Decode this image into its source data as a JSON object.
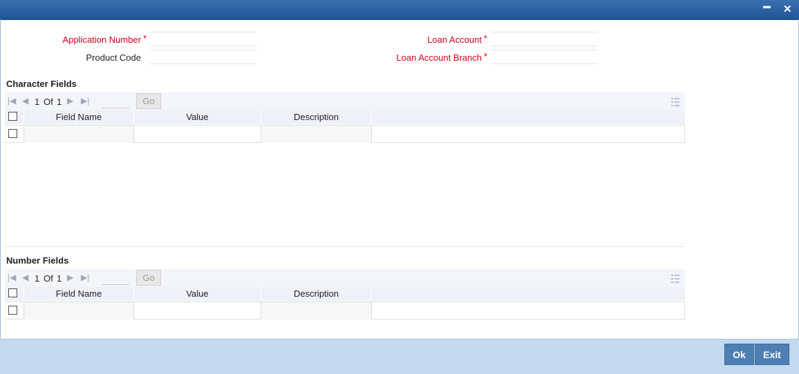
{
  "titlebar": {
    "minimize_glyph": "▬",
    "close_glyph": "✕"
  },
  "form": {
    "application_number_label": "Application Number",
    "product_code_label": "Product Code",
    "loan_account_label": "Loan Account",
    "loan_account_branch_label": "Loan Account Branch",
    "required_marker": "*",
    "application_number_value": "",
    "product_code_value": "",
    "loan_account_value": "",
    "loan_account_branch_value": ""
  },
  "character_fields": {
    "title": "Character Fields",
    "page_current": "1",
    "page_of": "Of",
    "page_total": "1",
    "go_label": "Go",
    "columns": [
      "Field Name",
      "Value",
      "Description"
    ]
  },
  "number_fields": {
    "title": "Number Fields",
    "page_current": "1",
    "page_of": "Of",
    "page_total": "1",
    "go_label": "Go",
    "columns": [
      "Field Name",
      "Value",
      "Description"
    ]
  },
  "footer": {
    "ok_label": "Ok",
    "exit_label": "Exit"
  },
  "colors": {
    "titlebar": "#2a5fa3",
    "required": "#d0021b",
    "footer": "#c2d9ee",
    "button": "#4d7fb3"
  }
}
